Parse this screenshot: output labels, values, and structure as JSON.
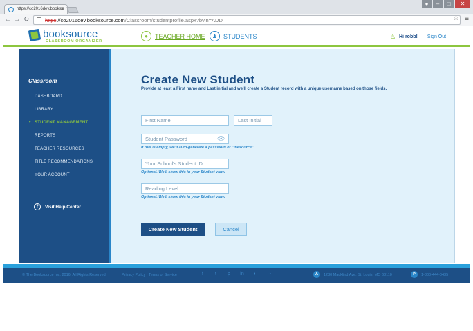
{
  "browser": {
    "tab_title": "https://co2016dev.bookso",
    "url_strike": "https",
    "url_host": "://co2016dev.booksource.com",
    "url_path": "/Classroom/studentprofile.aspx?bvin=ADD"
  },
  "header": {
    "logo": "booksource",
    "logo_sub": "CLASSROOM ORGANIZER",
    "nav": [
      {
        "label": "TEACHER HOME"
      },
      {
        "label": "STUDENTS"
      }
    ],
    "greeting": "Hi robb!",
    "signout": "Sign Out"
  },
  "sidebar": {
    "title": "Classroom",
    "items": [
      {
        "label": "DASHBOARD"
      },
      {
        "label": "LIBRARY"
      },
      {
        "label": "STUDENT MANAGEMENT"
      },
      {
        "label": "REPORTS"
      },
      {
        "label": "TEACHER RESOURCES"
      },
      {
        "label": "TITLE RECOMMENDATIONS"
      },
      {
        "label": "YOUR ACCOUNT"
      }
    ],
    "help": "Visit Help Center"
  },
  "form": {
    "title": "Create New Student",
    "description": "Provide at least a First name and Last initial and we'll create a Student record with a unique username based on those fields.",
    "first_name_placeholder": "First Name",
    "last_initial_placeholder": "Last Initial",
    "password_placeholder": "Student Password",
    "password_hint": "If this is empty, we'll auto-generate a password of \"thesource\"",
    "school_id_placeholder": "Your School's Student ID",
    "school_id_hint": "Optional. We'll show this in your Student view.",
    "reading_level_placeholder": "Reading Level",
    "reading_level_hint": "Optional. We'll show this in your Student view.",
    "create_button": "Create New Student",
    "cancel_button": "Cancel"
  },
  "footer": {
    "copyright": "© The Booksource Inc. 2016. All Rights Reserved",
    "privacy": "Privacy Policy",
    "terms": "Terms of Service",
    "separator": "|",
    "address_badge": "A",
    "address": "1230 Macklind Ave. St. Louis, MO 63110",
    "phone_badge": "P",
    "phone": "1-800-444-0435"
  }
}
